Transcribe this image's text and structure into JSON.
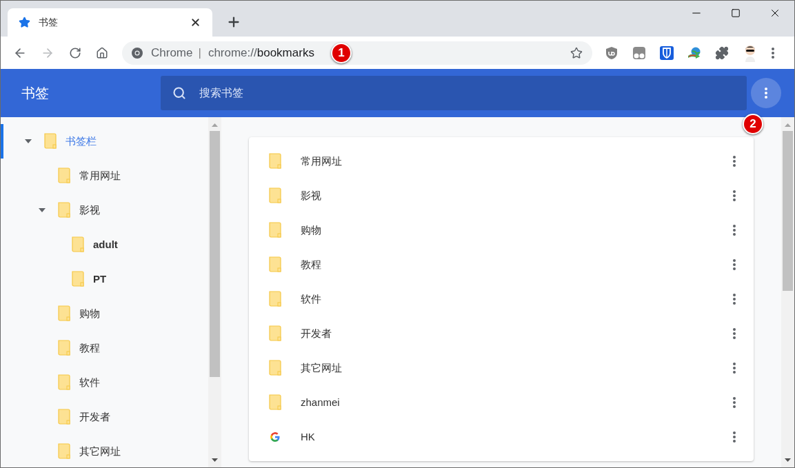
{
  "tab": {
    "title": "书签",
    "selected": true
  },
  "omnibox": {
    "origin_label": "Chrome",
    "separator": "|",
    "url_scheme": "chrome://",
    "url_path": "bookmarks"
  },
  "callouts": [
    "1",
    "2"
  ],
  "header": {
    "title": "书签",
    "search_placeholder": "搜索书签"
  },
  "sidebar": {
    "items": [
      {
        "label": "书签栏",
        "selected": true,
        "expanded": true,
        "children": [
          {
            "label": "常用网址",
            "selected": false
          },
          {
            "label": "影视",
            "selected": false,
            "expanded": true,
            "children": [
              {
                "label": "adult",
                "selected": false
              },
              {
                "label": "PT",
                "selected": false
              }
            ]
          },
          {
            "label": "购物",
            "selected": false
          },
          {
            "label": "教程",
            "selected": false
          },
          {
            "label": "软件",
            "selected": false
          },
          {
            "label": "开发者",
            "selected": false
          },
          {
            "label": "其它网址",
            "selected": false
          }
        ]
      }
    ]
  },
  "list": [
    {
      "kind": "folder",
      "label": "常用网址"
    },
    {
      "kind": "folder",
      "label": "影视"
    },
    {
      "kind": "folder",
      "label": "购物"
    },
    {
      "kind": "folder",
      "label": "教程"
    },
    {
      "kind": "folder",
      "label": "软件"
    },
    {
      "kind": "folder",
      "label": "开发者"
    },
    {
      "kind": "folder",
      "label": "其它网址"
    },
    {
      "kind": "folder",
      "label": "zhanmei"
    },
    {
      "kind": "site",
      "label": "HK"
    }
  ]
}
